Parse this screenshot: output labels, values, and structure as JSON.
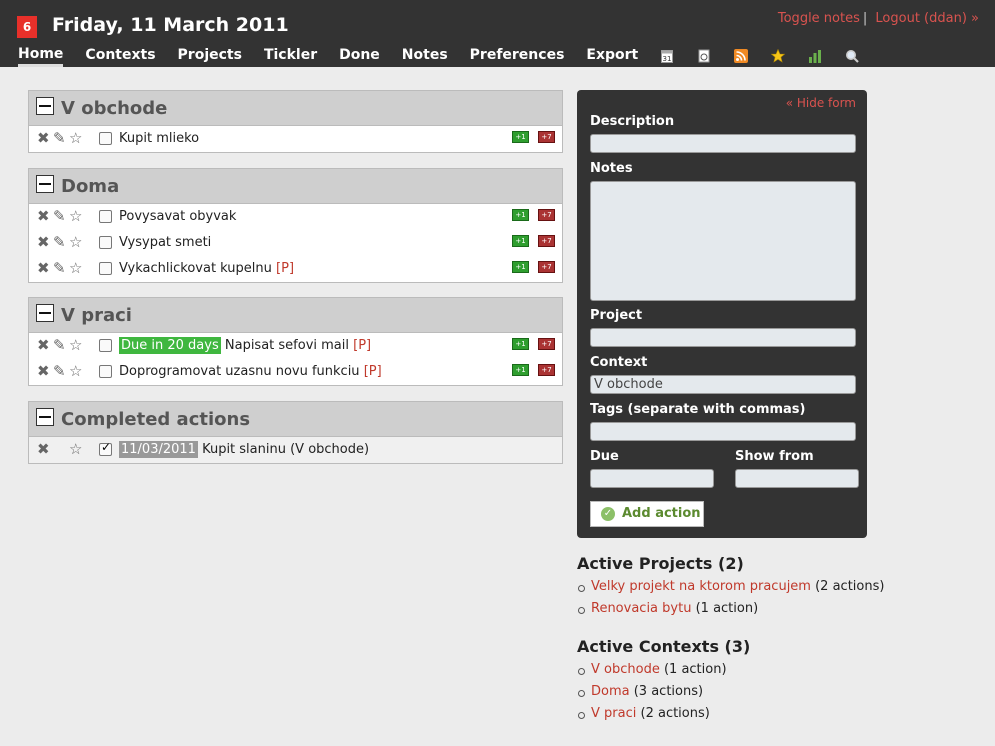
{
  "header": {
    "badge": "6",
    "date": "Friday, 11 March 2011",
    "toggle_notes": "Toggle notes",
    "logout": "Logout (ddan) »",
    "nav": [
      "Home",
      "Contexts",
      "Projects",
      "Tickler",
      "Done",
      "Notes",
      "Preferences",
      "Export"
    ],
    "nav_icons": [
      "calendar-icon",
      "print-icon",
      "rss-icon",
      "star-icon",
      "stats-icon",
      "search-icon"
    ]
  },
  "contexts": [
    {
      "title": "V obchode",
      "items": [
        {
          "text": "Kupit mlieko",
          "project": "",
          "due": ""
        }
      ]
    },
    {
      "title": "Doma",
      "items": [
        {
          "text": "Povysavat obyvak",
          "project": "",
          "due": ""
        },
        {
          "text": "Vysypat smeti",
          "project": "",
          "due": ""
        },
        {
          "text": "Vykachlickovat kupelnu",
          "project": "[P]",
          "due": ""
        }
      ]
    },
    {
      "title": "V praci",
      "items": [
        {
          "text": "Napisat sefovi mail",
          "project": "[P]",
          "due": "Due in 20 days"
        },
        {
          "text": "Doprogramovat uzasnu novu funkciu",
          "project": "[P]",
          "due": ""
        }
      ]
    }
  ],
  "completed": {
    "title": "Completed actions",
    "items": [
      {
        "date": "11/03/2011",
        "text": "Kupit slaninu (V obchode)"
      }
    ]
  },
  "defer": {
    "plus1": "+1",
    "plus7": "+7"
  },
  "form": {
    "hide_form": "« Hide form",
    "description_label": "Description",
    "notes_label": "Notes",
    "project_label": "Project",
    "context_label": "Context",
    "context_value": "V obchode",
    "tags_label": "Tags (separate with commas)",
    "due_label": "Due",
    "show_from_label": "Show from",
    "add_button": "Add action"
  },
  "active_projects": {
    "title": "Active Projects (2)",
    "items": [
      {
        "name": "Velky projekt na ktorom pracujem",
        "count": "(2 actions)"
      },
      {
        "name": "Renovacia bytu",
        "count": "(1 action)"
      }
    ]
  },
  "active_contexts": {
    "title": "Active Contexts (3)",
    "items": [
      {
        "name": "V obchode",
        "count": "(1 action)"
      },
      {
        "name": "Doma",
        "count": "(3 actions)"
      },
      {
        "name": "V praci",
        "count": "(2 actions)"
      }
    ]
  },
  "colors": {
    "header_bg": "#333333",
    "link_red": "#c0392b",
    "due_green": "#3fb73f",
    "badge_red": "#e8302a"
  }
}
